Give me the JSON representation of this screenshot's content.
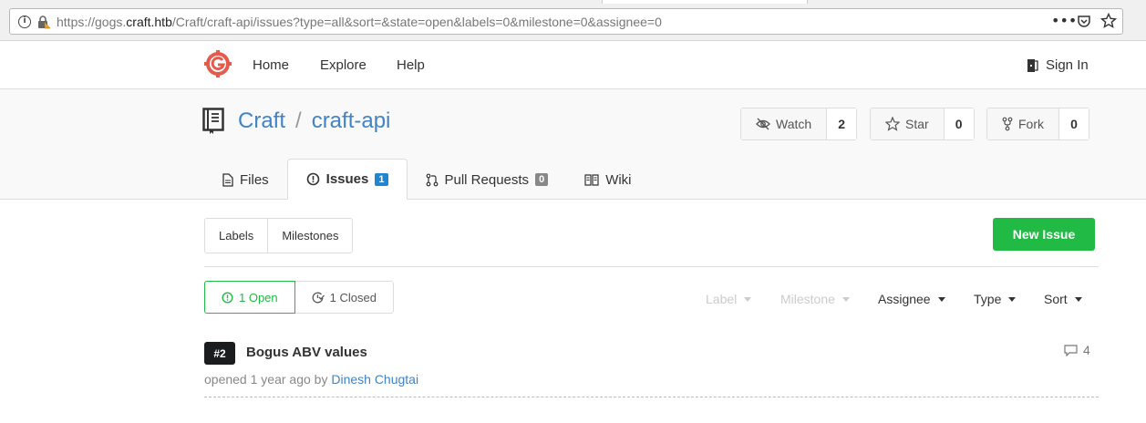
{
  "browser": {
    "url_prefix": "https://gogs.",
    "url_domain": "craft.htb",
    "url_suffix": "/Craft/craft-api/issues?type=all&sort=&state=open&labels=0&milestone=0&assignee=0",
    "more_icon": "more-icon",
    "pocket_icon": "pocket-icon",
    "star_icon": "star-icon"
  },
  "nav": {
    "items": [
      "Home",
      "Explore",
      "Help"
    ],
    "signin": "Sign In"
  },
  "repo": {
    "owner": "Craft",
    "separator": "/",
    "name": "craft-api",
    "watch": {
      "label": "Watch",
      "count": "2"
    },
    "star": {
      "label": "Star",
      "count": "0"
    },
    "fork": {
      "label": "Fork",
      "count": "0"
    }
  },
  "tabs": [
    {
      "label": "Files"
    },
    {
      "label": "Issues",
      "badge": "1"
    },
    {
      "label": "Pull Requests",
      "badge": "0"
    },
    {
      "label": "Wiki"
    }
  ],
  "toolbar": {
    "labels": "Labels",
    "milestones": "Milestones",
    "new_issue": "New Issue"
  },
  "states": {
    "open": "1 Open",
    "closed": "1 Closed"
  },
  "filters": {
    "label": "Label",
    "milestone": "Milestone",
    "assignee": "Assignee",
    "type": "Type",
    "sort": "Sort"
  },
  "issues": [
    {
      "number": "#2",
      "title": "Bogus ABV values",
      "comments": "4",
      "opened": "opened 1 year ago by",
      "author": "Dinesh Chugtai"
    }
  ],
  "colors": {
    "accent": "#4183c4",
    "green": "#21ba45",
    "blue_badge": "#2185d0"
  }
}
